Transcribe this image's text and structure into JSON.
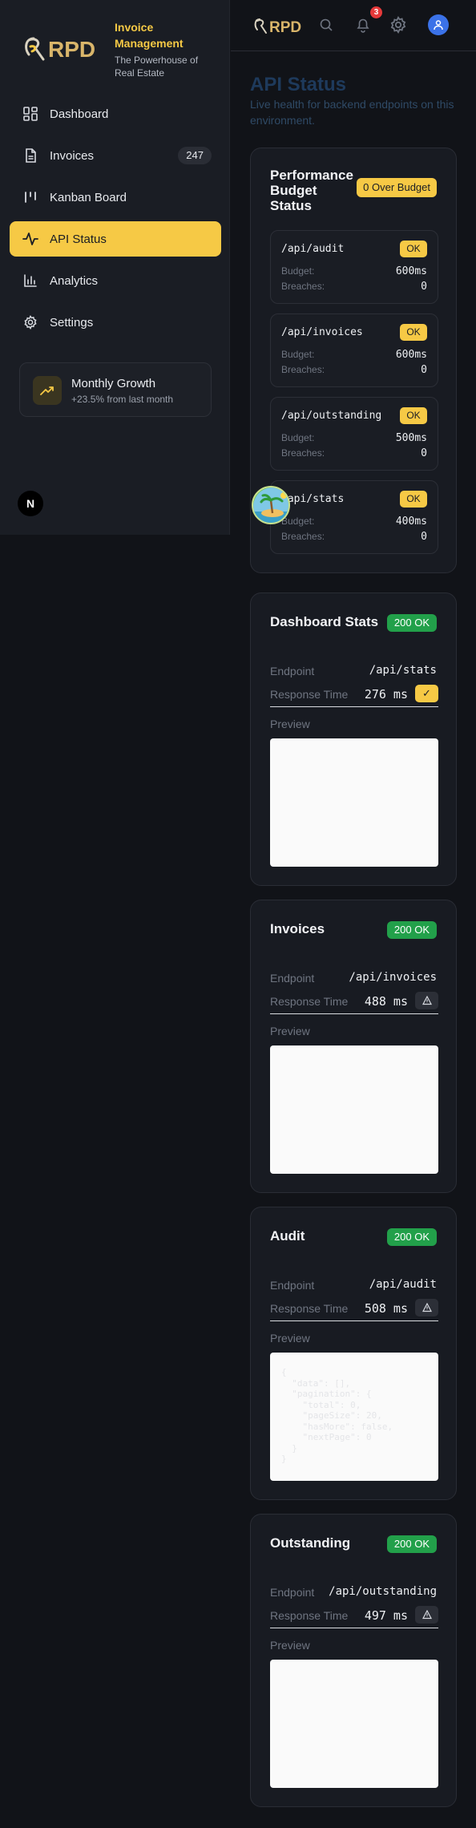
{
  "brand": {
    "title": "Invoice Management",
    "subtitle": "The Powerhouse of Real Estate",
    "logo_text": "RPD"
  },
  "sidebar": {
    "items": [
      {
        "label": "Dashboard",
        "icon": "dashboard-grid-icon",
        "active": false
      },
      {
        "label": "Invoices",
        "icon": "file-text-icon",
        "badge": "247",
        "active": false
      },
      {
        "label": "Kanban Board",
        "icon": "kanban-columns-icon",
        "active": false
      },
      {
        "label": "API Status",
        "icon": "activity-pulse-icon",
        "active": true
      },
      {
        "label": "Analytics",
        "icon": "bar-chart-icon",
        "active": false
      },
      {
        "label": "Settings",
        "icon": "gear-icon",
        "active": false
      }
    ],
    "growth": {
      "title": "Monthly Growth",
      "subtitle": "+23.5% from last month",
      "icon": "trending-up-icon"
    },
    "framework_logo": "N"
  },
  "header": {
    "logo_text": "RPD",
    "notification_count": "3",
    "icons": [
      "search-icon",
      "bell-icon",
      "gear-icon",
      "user-avatar-icon"
    ]
  },
  "page": {
    "title": "API Status",
    "subtitle": "Live health for backend endpoints on this environment."
  },
  "budget": {
    "title": "Performance Budget Status",
    "badge": "0 Over Budget",
    "budget_label": "Budget:",
    "breaches_label": "Breaches:",
    "ok_label": "OK",
    "endpoints": [
      {
        "path": "/api/audit",
        "budget": "600ms",
        "breaches": "0"
      },
      {
        "path": "/api/invoices",
        "budget": "600ms",
        "breaches": "0"
      },
      {
        "path": "/api/outstanding",
        "budget": "500ms",
        "breaches": "0"
      },
      {
        "path": "/api/stats",
        "budget": "400ms",
        "breaches": "0"
      }
    ]
  },
  "labels": {
    "endpoint": "Endpoint",
    "response_time": "Response Time",
    "preview": "Preview"
  },
  "services": [
    {
      "title": "Dashboard Stats",
      "status": "200 OK",
      "endpoint": "/api/stats",
      "response": "276 ms",
      "flag": "check-icon",
      "preview": ""
    },
    {
      "title": "Invoices",
      "status": "200 OK",
      "endpoint": "/api/invoices",
      "response": "488 ms",
      "flag": "warning-icon",
      "preview": ""
    },
    {
      "title": "Audit",
      "status": "200 OK",
      "endpoint": "/api/audit",
      "response": "508 ms",
      "flag": "warning-icon",
      "preview": "{\n  \"data\": [],\n  \"pagination\": {\n    \"total\": 0,\n    \"pageSize\": 20,\n    \"hasMore\": false,\n    \"nextPage\": 0\n  }\n}"
    },
    {
      "title": "Outstanding",
      "status": "200 OK",
      "endpoint": "/api/outstanding",
      "response": "497 ms",
      "flag": "warning-icon",
      "preview": ""
    }
  ],
  "colors": {
    "accent": "#f6c945",
    "success": "#22a04a",
    "background": "#111318",
    "danger": "#e5393a"
  }
}
